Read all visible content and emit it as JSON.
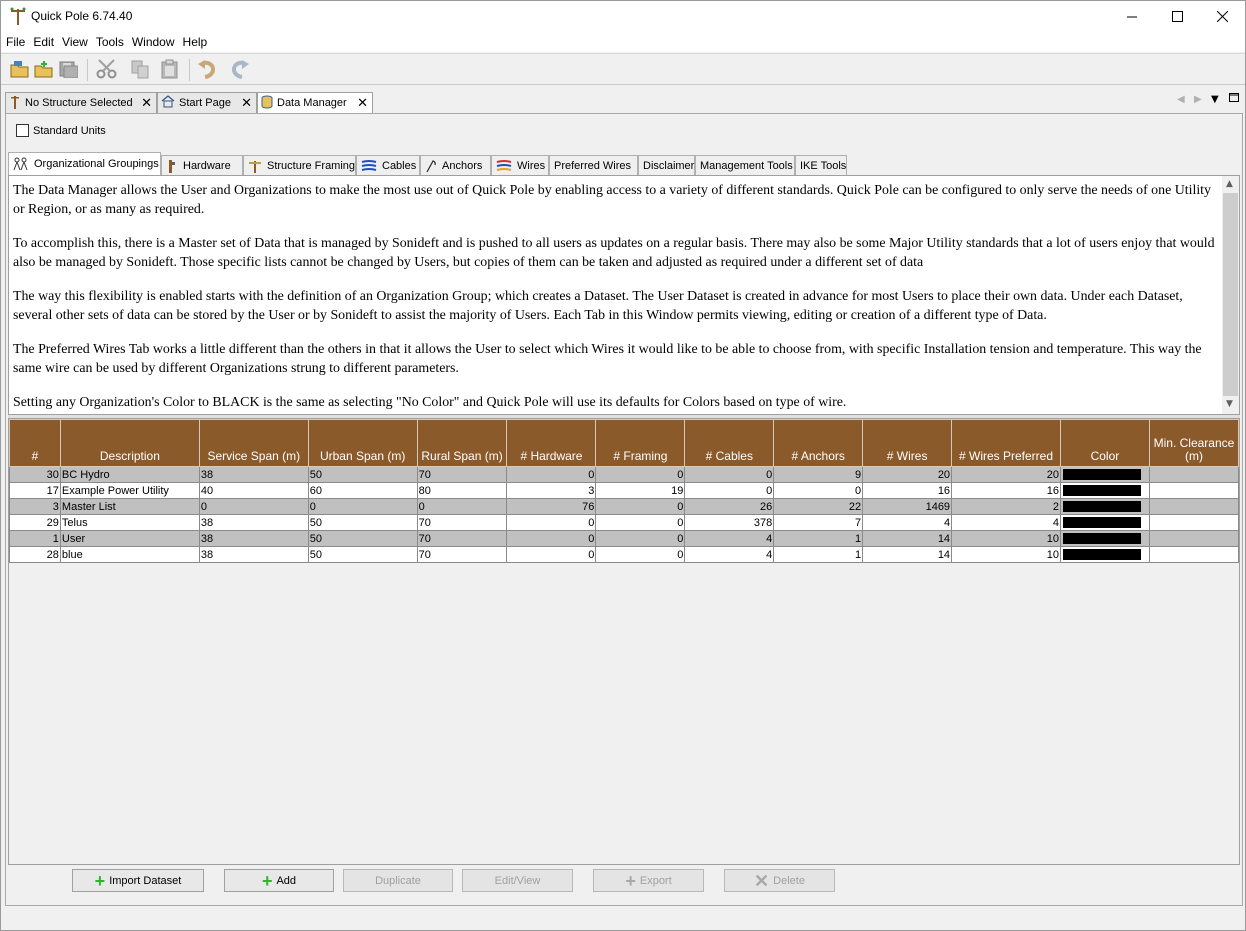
{
  "app": {
    "title": "Quick Pole 6.74.40"
  },
  "menu": {
    "items": [
      "File",
      "Edit",
      "View",
      "Tools",
      "Window",
      "Help"
    ]
  },
  "doc_tabs": [
    {
      "label": "No Structure Selected",
      "icon": "pole-icon"
    },
    {
      "label": "Start Page",
      "icon": "home-icon"
    },
    {
      "label": "Data Manager",
      "icon": "database-icon",
      "active": true
    }
  ],
  "standard_units": {
    "label": "Standard Units",
    "checked": false
  },
  "sub_tabs": [
    {
      "label": "Organizational Groupings",
      "icon": "org-groupings-icon",
      "active": true
    },
    {
      "label": "Hardware",
      "icon": "hardware-icon"
    },
    {
      "label": "Structure Framing",
      "icon": "framing-icon"
    },
    {
      "label": "Cables",
      "icon": "cables-icon"
    },
    {
      "label": "Anchors",
      "icon": "anchor-icon"
    },
    {
      "label": "Wires",
      "icon": "wires-icon"
    },
    {
      "label": "Preferred Wires"
    },
    {
      "label": "Disclaimer"
    },
    {
      "label": "Management Tools"
    },
    {
      "label": "IKE Tools"
    }
  ],
  "description": {
    "paragraphs": [
      "The Data Manager allows the User and Organizations to make the most use out of Quick Pole by enabling access to a variety of different standards. Quick Pole can be configured to only serve the needs of one Utility or Region, or as many as required.",
      "To accomplish this, there is a Master set of Data that is managed by Sonideft and is pushed to all users as updates on a regular basis. There may also be some Major Utility standards that a lot of users enjoy that would also be managed by Sonideft. Those specific lists cannot be changed by Users, but copies of them can be taken and adjusted as required under a different set of data",
      "The way this flexibility is enabled starts with the definition of an Organization Group; which creates a Dataset. The User Dataset is created in advance for most Users to place their own data. Under each Dataset, several other sets of data can be stored by the User or by Sonideft to assist the majority of Users. Each Tab in this Window permits viewing, editing or creation of a different type of Data.",
      "The Preferred Wires Tab works a little different than the others in that it allows the User to select which Wires it would like to be able to choose from, with specific Installation tension and temperature. This way the same wire can be used by different Organizations strung to different parameters.",
      "Setting any Organization's Color to BLACK is the same as selecting \"No Color\" and Quick Pole will use its defaults for Colors based on type of wire."
    ]
  },
  "table": {
    "columns": [
      "#",
      "Description",
      "Service Span (m)",
      "Urban Span (m)",
      "Rural Span (m)",
      "# Hardware",
      "# Framing",
      "# Cables",
      "# Anchors",
      "# Wires",
      "# Wires Preferred",
      "Color",
      "Min. Clearance (m)"
    ],
    "rows": [
      {
        "id": "30",
        "description": "BC Hydro",
        "service": "38",
        "urban": "50",
        "rural": "70",
        "hardware": "0",
        "framing": "0",
        "cables": "0",
        "anchors": "9",
        "wires": "20",
        "preferred": "20",
        "color": "#000000",
        "clearance": ""
      },
      {
        "id": "17",
        "description": "Example Power Utility",
        "service": "40",
        "urban": "60",
        "rural": "80",
        "hardware": "3",
        "framing": "19",
        "cables": "0",
        "anchors": "0",
        "wires": "16",
        "preferred": "16",
        "color": "#000000",
        "clearance": ""
      },
      {
        "id": "3",
        "description": "Master List",
        "service": "0",
        "urban": "0",
        "rural": "0",
        "hardware": "76",
        "framing": "0",
        "cables": "26",
        "anchors": "22",
        "wires": "1469",
        "preferred": "2",
        "color": "#000000",
        "clearance": ""
      },
      {
        "id": "29",
        "description": "Telus",
        "service": "38",
        "urban": "50",
        "rural": "70",
        "hardware": "0",
        "framing": "0",
        "cables": "378",
        "anchors": "7",
        "wires": "4",
        "preferred": "4",
        "color": "#000000",
        "clearance": ""
      },
      {
        "id": "1",
        "description": "User",
        "service": "38",
        "urban": "50",
        "rural": "70",
        "hardware": "0",
        "framing": "0",
        "cables": "4",
        "anchors": "1",
        "wires": "14",
        "preferred": "10",
        "color": "#000000",
        "clearance": ""
      },
      {
        "id": "28",
        "description": "blue",
        "service": "38",
        "urban": "50",
        "rural": "70",
        "hardware": "0",
        "framing": "0",
        "cables": "4",
        "anchors": "1",
        "wires": "14",
        "preferred": "10",
        "color": "#000000",
        "clearance": ""
      }
    ]
  },
  "buttons": {
    "import": "Import Dataset",
    "add": "Add",
    "duplicate": "Duplicate",
    "edit": "Edit/View",
    "export": "Export",
    "delete": "Delete"
  },
  "colors": {
    "header_bg": "#8b5a2b",
    "row_alt": "#c0c0c0",
    "add_green": "#2db52d"
  }
}
